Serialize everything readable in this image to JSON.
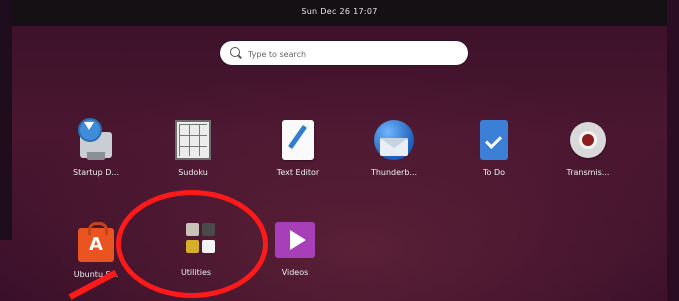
{
  "topbar": {
    "clock": "Sun Dec 26  17:07"
  },
  "search": {
    "placeholder": "Type to search"
  },
  "apps": [
    {
      "label": "Startup D...",
      "icon": "startup-disk-creator-icon"
    },
    {
      "label": "Sudoku",
      "icon": "sudoku-icon"
    },
    {
      "label": "Text Editor",
      "icon": "text-editor-icon"
    },
    {
      "label": "Thunderb...",
      "icon": "thunderbird-icon"
    },
    {
      "label": "To Do",
      "icon": "todo-icon"
    },
    {
      "label": "Transmis...",
      "icon": "transmission-icon"
    },
    {
      "label": "Ubuntu S...",
      "icon": "ubuntu-software-icon"
    },
    {
      "label": "Utilities",
      "icon": "utilities-folder-icon"
    },
    {
      "label": "Videos",
      "icon": "videos-icon"
    }
  ],
  "colors": {
    "annotation": "#ff1a1a",
    "accent_orange": "#e95420",
    "background": "#3b1129"
  }
}
